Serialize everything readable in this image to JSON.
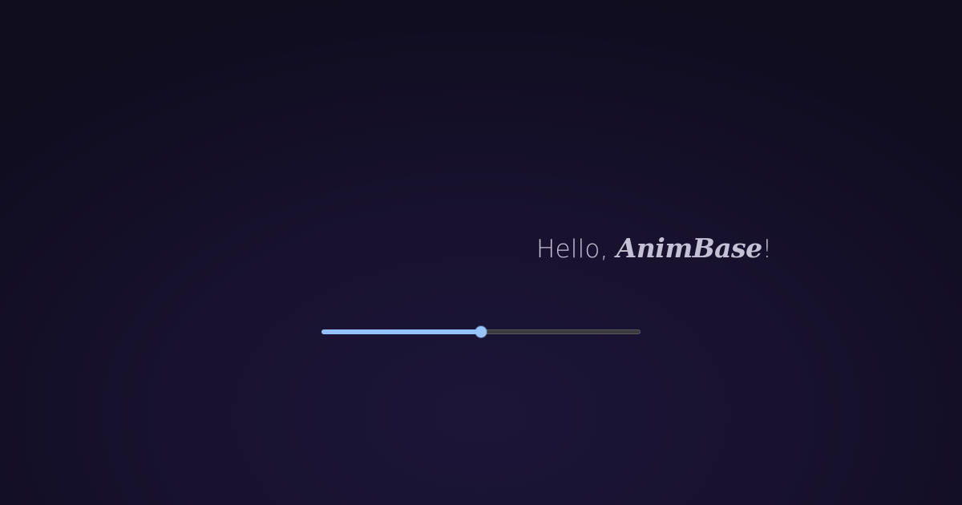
{
  "greeting": {
    "prefix": "Hello, ",
    "brand": "AnimBase",
    "suffix": "!"
  },
  "slider": {
    "value": 0.5,
    "fill_color": "#93c2fb",
    "track_color": "#3b3a3f",
    "thumb_color": "#96c4fc"
  },
  "colors": {
    "text": "#c4c1d6",
    "background": "#1a1433"
  }
}
